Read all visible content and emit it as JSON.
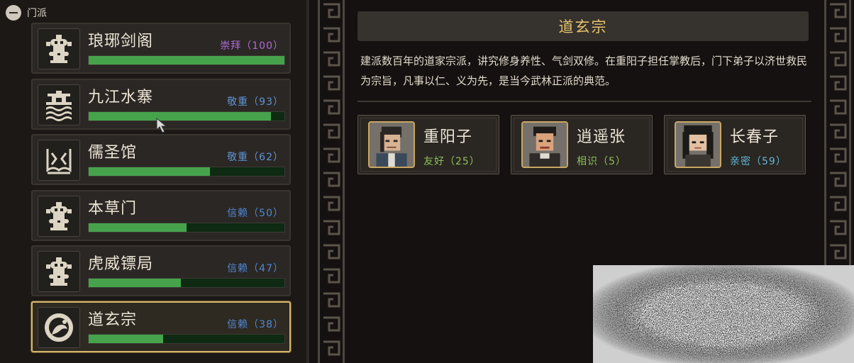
{
  "section": {
    "label": "门派"
  },
  "factions": [
    {
      "name": "琅琊剑阁",
      "relation": "崇拜（100）",
      "relation_color": "#b06ad8",
      "progress": 1.0,
      "emblem": "clan-crest-icon"
    },
    {
      "name": "九江水寨",
      "relation": "敬重（93）",
      "relation_color": "#5f94d6",
      "progress": 0.93,
      "emblem": "pagoda-waves-icon"
    },
    {
      "name": "儒圣馆",
      "relation": "敬重（62）",
      "relation_color": "#5f94d6",
      "progress": 0.62,
      "emblem": "scholar-scroll-icon"
    },
    {
      "name": "本草门",
      "relation": "信赖（50）",
      "relation_color": "#4f88d4",
      "progress": 0.5,
      "emblem": "clan-crest-icon"
    },
    {
      "name": "虎威镖局",
      "relation": "信赖（47）",
      "relation_color": "#4f88d4",
      "progress": 0.47,
      "emblem": "clan-crest-icon"
    },
    {
      "name": "道玄宗",
      "relation": "信赖（38）",
      "relation_color": "#4f88d4",
      "progress": 0.38,
      "emblem": "crane-icon",
      "selected": true
    }
  ],
  "detail": {
    "title": "道玄宗",
    "description": "建派数百年的道家宗派，讲究修身养性、气剑双修。在重阳子担任掌教后，门下弟子以济世救民为宗旨，凡事以仁、义为先，是当今武林正派的典范。"
  },
  "members": [
    {
      "name": "重阳子",
      "relation": "友好（25）",
      "relation_color": "#8cc25a"
    },
    {
      "name": "逍遥张",
      "relation": "相识（5）",
      "relation_color": "#8cc25a"
    },
    {
      "name": "长春子",
      "relation": "亲密（59）",
      "relation_color": "#62b6d6"
    }
  ],
  "colors": {
    "accent_gold": "#e6c36d",
    "bar_green": "#46a34c",
    "selected_border": "#d4b56a"
  }
}
